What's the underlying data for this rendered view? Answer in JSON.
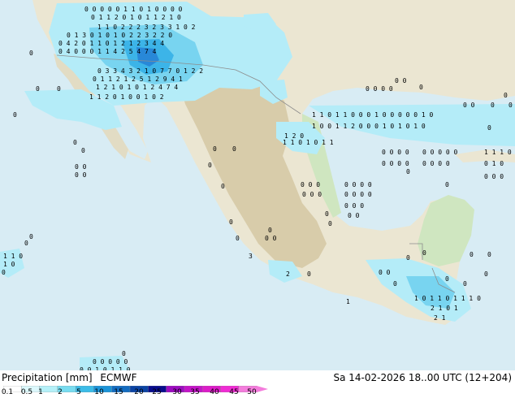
{
  "title": "Precipitation [mm]",
  "model": "ECMWF",
  "run_info": "Sa 14-02-2026 18..00 UTC (12+204)",
  "scale": {
    "ticks": [
      "0.1",
      "0.5",
      "1",
      "2",
      "5",
      "10",
      "15",
      "20",
      "25",
      "30",
      "35",
      "40",
      "45",
      "50"
    ],
    "colors": [
      "#ffffff",
      "#dcf8fc",
      "#b4f0f8",
      "#78dcf0",
      "#3cbce8",
      "#1c94d8",
      "#146cc0",
      "#0c44a4",
      "#080c8c",
      "#9c0cc0",
      "#c414c8",
      "#dc1cc8",
      "#f02cd4",
      "#f47cdc"
    ]
  },
  "map_colors": {
    "ocean": "#d8ecf4",
    "land": "#ebe6d2",
    "highland": "#d8ccaa",
    "lowland": "#cfe6c0",
    "precip_light": "#b4ecf8",
    "precip_med": "#78d4f0",
    "precip_heavy": "#3cb4e8",
    "precip_strong": "#2888d8"
  },
  "precip_labels": [
    "0 0 0 0 0   1 1 0 1 0   0 0 0",
    "0 1 1 2 0 1 0 1 1 2   1 0",
    "1 1 0 2 2 2 3 2 3 3 1 0 2",
    "0 1 3 0 1 0 1 0 2 2 3 2 2 0",
    "0 4 2 0 1 1 0 1 2 1 2 3 4 4",
    "0 4 0 0 0 1 1 4 2 5 4 7 4",
    "0 3 3 4 3 2 1 0 7 7 0 1 2 2",
    "0 1 1 2 1 2 5 1 2 9 4 1",
    "1 2 1 0   1 0 1 2 4 7 4",
    "1 1 2 0   1 0 0 1 0 2",
    "1 1 0 1 1 0 0 0 1 0 0 0 0 0 1 0",
    "1 0 0 1 1 2 0 0 0 1 0 1 0 1 0",
    "1 2 0",
    "1 1 0 1 0 1 1",
    "1 0 1 1 0 1 1 1 0",
    "2 1 0 1",
    "2 1"
  ]
}
